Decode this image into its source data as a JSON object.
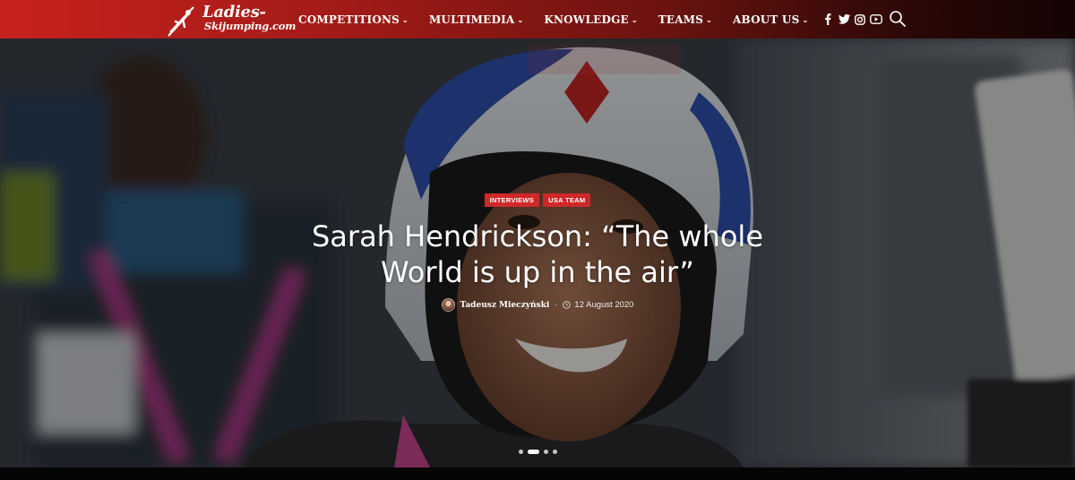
{
  "brand": {
    "logo_line1": "Ladies-",
    "logo_line2": "Skijumping.com",
    "colors": {
      "header_start": "#c8221e",
      "header_end": "#140403",
      "category_badge": "#d0282a"
    }
  },
  "nav": {
    "items": [
      {
        "label": "COMPETITIONS",
        "icon": "chevron-down-icon"
      },
      {
        "label": "MULTIMEDIA",
        "icon": "chevron-down-icon"
      },
      {
        "label": "KNOWLEDGE",
        "icon": "chevron-down-icon"
      },
      {
        "label": "TEAMS",
        "icon": "chevron-down-icon"
      },
      {
        "label": "ABOUT US",
        "icon": "chevron-down-icon"
      }
    ]
  },
  "social": {
    "icons": [
      "facebook-icon",
      "twitter-icon",
      "instagram-icon",
      "youtube-icon"
    ],
    "search_icon": "search-icon"
  },
  "hero": {
    "categories": [
      "INTERVIEWS",
      "USA TEAM"
    ],
    "title": "Sarah Hendrickson: “The whole World is up in the air”",
    "author": "Tadeusz Mieczyński",
    "date": "12 August 2020",
    "slider": {
      "total": 4,
      "active_index": 1
    }
  }
}
